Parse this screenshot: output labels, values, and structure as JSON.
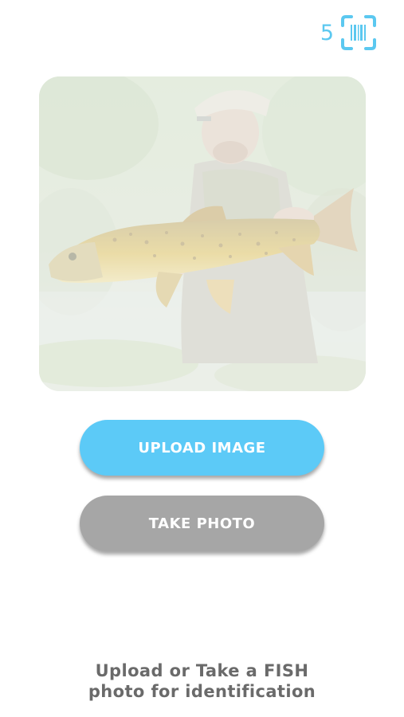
{
  "header": {
    "scan_count": "5",
    "scan_icon": "barcode-scan-icon",
    "accent_color": "#5bc8f0"
  },
  "hero": {
    "image": "fisherman-holding-brown-trout"
  },
  "actions": {
    "upload_label": "UPLOAD IMAGE",
    "upload_color": "#5ccaf7",
    "take_photo_label": "TAKE PHOTO",
    "take_photo_color": "#a6a6a6"
  },
  "instructions": {
    "line1": "Upload or Take a FISH",
    "line2": "photo for identification"
  }
}
